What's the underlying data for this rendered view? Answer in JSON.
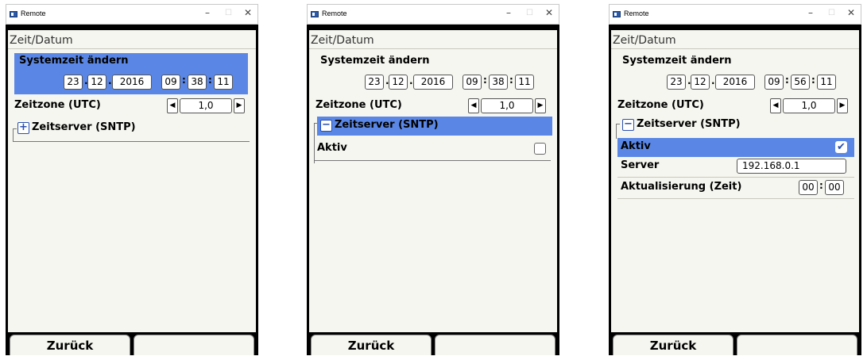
{
  "window": {
    "title": "Remote",
    "minimize_symbol": "–",
    "maximize_symbol": "☐",
    "close_symbol": "✕"
  },
  "panels": [
    {
      "heading": "Zeit/Datum",
      "systemzeit_label": "Systemzeit ändern",
      "date": {
        "day": "23",
        "month": "12",
        "year": "2016"
      },
      "time": {
        "hour": "09",
        "minute": "38",
        "second": "11"
      },
      "timezone_label": "Zeitzone (UTC)",
      "timezone_value": "1,0",
      "sntp_toggle": "+",
      "sntp_label": "Zeitserver (SNTP)",
      "footer": {
        "back": "Zurück",
        "right": ""
      }
    },
    {
      "heading": "Zeit/Datum",
      "systemzeit_label": "Systemzeit ändern",
      "date": {
        "day": "23",
        "month": "12",
        "year": "2016"
      },
      "time": {
        "hour": "09",
        "minute": "38",
        "second": "11"
      },
      "timezone_label": "Zeitzone (UTC)",
      "timezone_value": "1,0",
      "sntp_toggle": "−",
      "sntp_label": "Zeitserver (SNTP)",
      "aktiv_label": "Aktiv",
      "aktiv_checked": false,
      "footer": {
        "back": "Zurück",
        "right": ""
      }
    },
    {
      "heading": "Zeit/Datum",
      "systemzeit_label": "Systemzeit ändern",
      "date": {
        "day": "23",
        "month": "12",
        "year": "2016"
      },
      "time": {
        "hour": "09",
        "minute": "56",
        "second": "11"
      },
      "timezone_label": "Zeitzone (UTC)",
      "timezone_value": "1,0",
      "sntp_toggle": "−",
      "sntp_label": "Zeitserver (SNTP)",
      "aktiv_label": "Aktiv",
      "aktiv_checked": true,
      "server_label": "Server",
      "server_value": "192.168.0.1",
      "update_label": "Aktualisierung (Zeit)",
      "update_hour": "00",
      "update_minute": "00",
      "footer": {
        "back": "Zurück",
        "right": ""
      }
    }
  ],
  "icons": {
    "left_arrow": "◀",
    "right_arrow": "▶",
    "check": "✔",
    "selection_color": "#5a87e6"
  }
}
